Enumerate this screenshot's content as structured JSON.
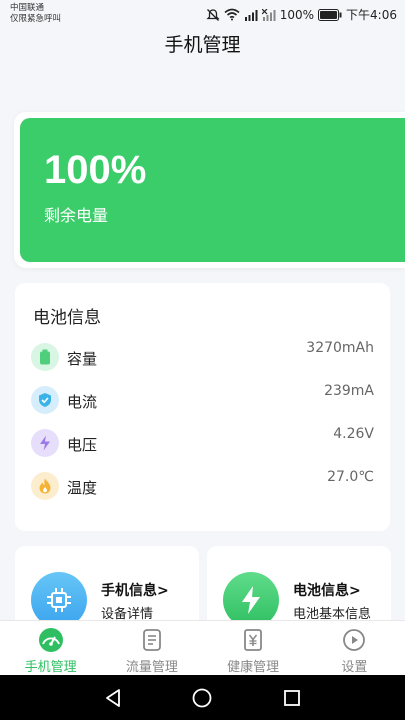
{
  "status_bar": {
    "carrier_line1": "中国联通",
    "carrier_line2": "仅限紧急呼叫",
    "battery_percent": "100%",
    "time": "下午4:06"
  },
  "header": {
    "title": "手机管理"
  },
  "battery_card": {
    "percent": "100%",
    "label": "剩余电量",
    "level": 1.0,
    "color": "#3ccd6b"
  },
  "battery_info": {
    "title": "电池信息",
    "rows": [
      {
        "icon": "battery-icon",
        "label": "容量",
        "value": "3270mAh",
        "color": "#4fcf7c"
      },
      {
        "icon": "shield-check-icon",
        "label": "电流",
        "value": "239mA",
        "color": "#3ab4e8"
      },
      {
        "icon": "lightning-icon",
        "label": "电压",
        "value": "4.26V",
        "color": "#9b7be8"
      },
      {
        "icon": "flame-icon",
        "label": "温度",
        "value": "27.0℃",
        "color": "#f5b335"
      }
    ]
  },
  "features": [
    {
      "icon": "chip-icon",
      "title": "手机信息>",
      "subtitle": "设备详情",
      "color": "#3aaef0"
    },
    {
      "icon": "lightning-icon",
      "title": "电池信息>",
      "subtitle": "电池基本信息",
      "color": "#3ccd6b"
    }
  ],
  "bottom_nav": {
    "items": [
      {
        "icon": "gauge-icon",
        "label": "手机管理",
        "active": true
      },
      {
        "icon": "document-icon",
        "label": "流量管理",
        "active": false
      },
      {
        "icon": "yen-icon",
        "label": "健康管理",
        "active": false
      },
      {
        "icon": "play-circle-icon",
        "label": "设置",
        "active": false
      }
    ]
  },
  "colors": {
    "accent": "#2fbf62",
    "background": "#f4f6f9"
  }
}
